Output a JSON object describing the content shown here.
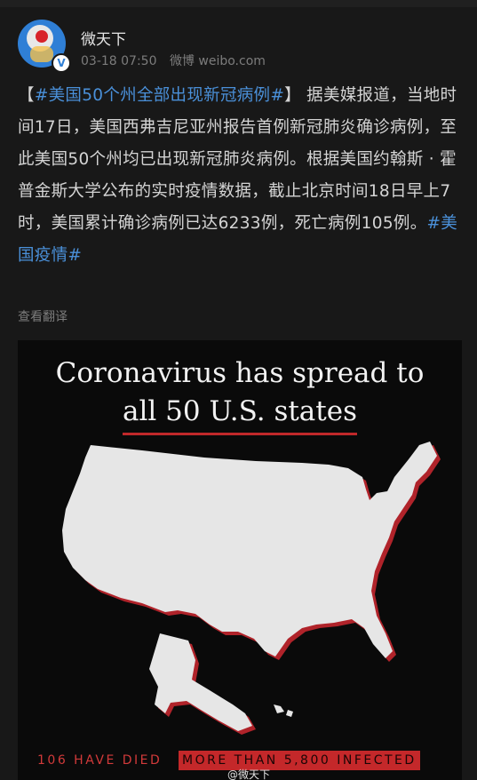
{
  "post": {
    "author": "微天下",
    "verified_badge": "V",
    "date": "03-18 07:50",
    "source": "微博 weibo.com",
    "bracket_open": "【",
    "hashtag_title": "#美国50个州全部出现新冠病例#",
    "bracket_close": "】",
    "body": "据美媒报道，当地时间17日，美国西弗吉尼亚州报告首例新冠肺炎确诊病例，至此美国50个州均已出现新冠肺炎病例。根据美国约翰斯 · 霍普金斯大学公布的实时疫情数据，截止北京时间18日早上7时，美国累计确诊病例已达6233例，死亡病例105例。",
    "hashtag_end": "#美国疫情#",
    "translate": "查看翻译"
  },
  "image": {
    "headline_line1": "Coronavirus has spread to",
    "headline_line2": "all 50 U.S. states",
    "died_text": "106 HAVE DIED",
    "infected_text": "MORE THAN 5,800 INFECTED",
    "watermark": "@微天下"
  },
  "colors": {
    "hashtag": "#4a90d9",
    "accent_red": "#c4282a",
    "map_fill": "#e6e6e6"
  }
}
